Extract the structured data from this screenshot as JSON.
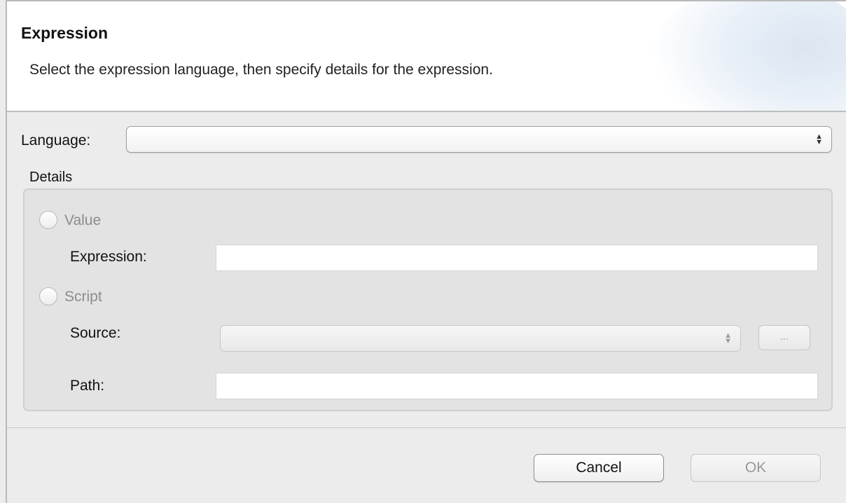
{
  "dialog": {
    "title": "Expression",
    "description": "Select the expression language, then specify details for the expression."
  },
  "language": {
    "label": "Language:",
    "value": ""
  },
  "details": {
    "label": "Details",
    "value_option": {
      "label": "Value",
      "selected": false,
      "enabled": false
    },
    "expression": {
      "label": "Expression:",
      "value": ""
    },
    "script_option": {
      "label": "Script",
      "selected": false,
      "enabled": false
    },
    "source": {
      "label": "Source:",
      "value": "",
      "browse_label": "..."
    },
    "path": {
      "label": "Path:",
      "value": ""
    }
  },
  "buttons": {
    "cancel_label": "Cancel",
    "ok_label": "OK",
    "ok_enabled": false
  },
  "colors": {
    "banner_bg": "#ffffff",
    "dialog_bg": "#ececec",
    "group_bg": "#e3e3e3",
    "disabled_text": "#9a9a9a"
  }
}
